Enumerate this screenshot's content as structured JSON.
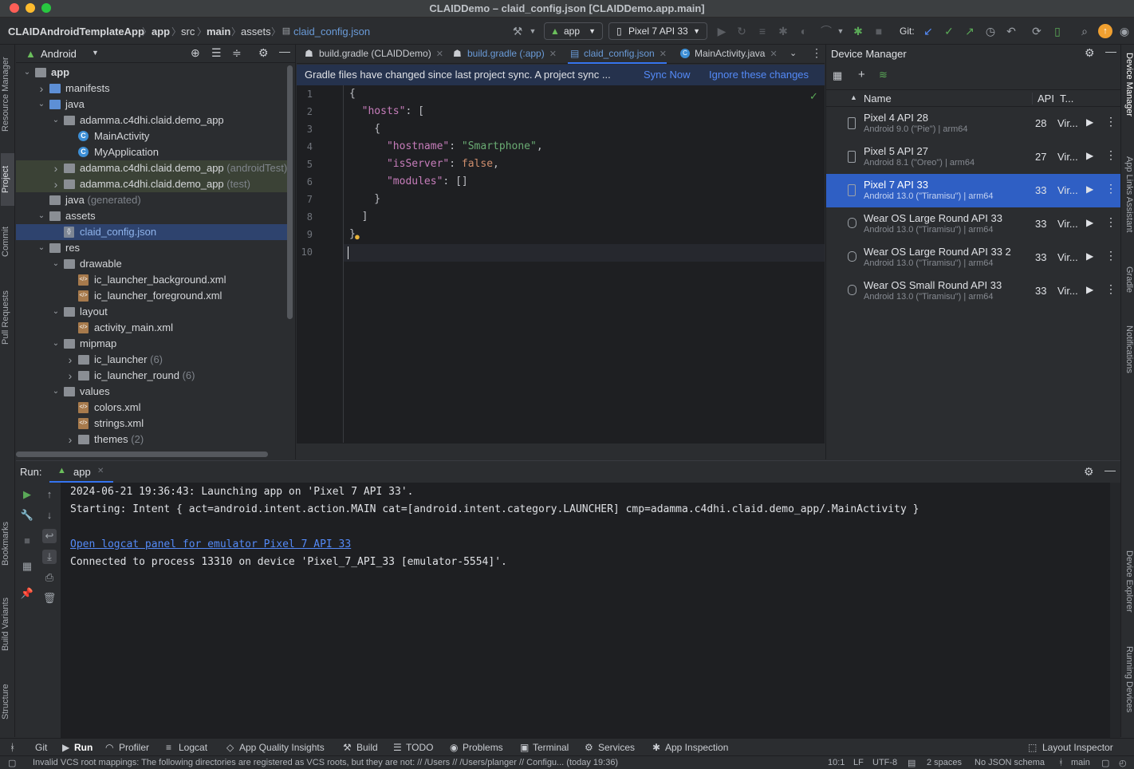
{
  "window": {
    "title": "CLAIDDemo – claid_config.json [CLAIDDemo.app.main]"
  },
  "breadcrumb": [
    "CLAIDAndroidTemplateApp",
    "app",
    "src",
    "main",
    "assets",
    "claid_config.json"
  ],
  "toolbar": {
    "run_config": "app",
    "device": "Pixel 7 API 33",
    "git_label": "Git:"
  },
  "left_tool_tabs": [
    "Resource Manager",
    "Project",
    "Commit",
    "Pull Requests",
    "Bookmarks",
    "Build Variants",
    "Structure"
  ],
  "right_tool_tabs": [
    "Device Manager",
    "App Links Assistant",
    "Gradle",
    "Notifications",
    "Device Explorer",
    "Running Devices"
  ],
  "project": {
    "view_label": "Android",
    "tree": [
      {
        "label": "app",
        "depth": 0,
        "chevron": "v",
        "icon": "folder",
        "bold": true
      },
      {
        "label": "manifests",
        "depth": 1,
        "chevron": ">",
        "icon": "folder-blue"
      },
      {
        "label": "java",
        "depth": 1,
        "chevron": "v",
        "icon": "folder-blue"
      },
      {
        "label": "adamma.c4dhi.claid.demo_app",
        "depth": 2,
        "chevron": "v",
        "icon": "folder"
      },
      {
        "label": "MainActivity",
        "depth": 3,
        "chevron": "",
        "icon": "class"
      },
      {
        "label": "MyApplication",
        "depth": 3,
        "chevron": "",
        "icon": "class"
      },
      {
        "label": "adamma.c4dhi.claid.demo_app",
        "suffix": "(androidTest)",
        "depth": 2,
        "chevron": ">",
        "icon": "folder",
        "hl": true
      },
      {
        "label": "adamma.c4dhi.claid.demo_app",
        "suffix": "(test)",
        "depth": 2,
        "chevron": ">",
        "icon": "folder",
        "hl": true
      },
      {
        "label": "java",
        "suffix": "(generated)",
        "depth": 1,
        "chevron": "",
        "icon": "folder"
      },
      {
        "label": "assets",
        "depth": 1,
        "chevron": "v",
        "icon": "folder"
      },
      {
        "label": "claid_config.json",
        "depth": 2,
        "chevron": "",
        "icon": "json",
        "sel": true
      },
      {
        "label": "res",
        "depth": 1,
        "chevron": "v",
        "icon": "folder"
      },
      {
        "label": "drawable",
        "depth": 2,
        "chevron": "v",
        "icon": "folder"
      },
      {
        "label": "ic_launcher_background.xml",
        "depth": 3,
        "chevron": "",
        "icon": "xml"
      },
      {
        "label": "ic_launcher_foreground.xml",
        "depth": 3,
        "chevron": "",
        "icon": "xml"
      },
      {
        "label": "layout",
        "depth": 2,
        "chevron": "v",
        "icon": "folder"
      },
      {
        "label": "activity_main.xml",
        "depth": 3,
        "chevron": "",
        "icon": "xml"
      },
      {
        "label": "mipmap",
        "depth": 2,
        "chevron": "v",
        "icon": "folder"
      },
      {
        "label": "ic_launcher",
        "suffix": "(6)",
        "depth": 3,
        "chevron": ">",
        "icon": "folder"
      },
      {
        "label": "ic_launcher_round",
        "suffix": "(6)",
        "depth": 3,
        "chevron": ">",
        "icon": "folder"
      },
      {
        "label": "values",
        "depth": 2,
        "chevron": "v",
        "icon": "folder"
      },
      {
        "label": "colors.xml",
        "depth": 3,
        "chevron": "",
        "icon": "xml"
      },
      {
        "label": "strings.xml",
        "depth": 3,
        "chevron": "",
        "icon": "xml"
      },
      {
        "label": "themes",
        "suffix": "(2)",
        "depth": 3,
        "chevron": ">",
        "icon": "folder"
      }
    ]
  },
  "editor": {
    "tabs": [
      {
        "label": "build.gradle (CLAIDDemo)",
        "active": false
      },
      {
        "label": "build.gradle (:app)",
        "active": false
      },
      {
        "label": "claid_config.json",
        "active": true
      },
      {
        "label": "MainActivity.java",
        "active": false
      }
    ],
    "sync_message": "Gradle files have changed since last project sync. A project sync ...",
    "sync_now": "Sync Now",
    "ignore": "Ignore these changes",
    "lines": [
      [
        "1",
        "{"
      ],
      [
        "2",
        "  \"hosts\": ["
      ],
      [
        "3",
        "    {"
      ],
      [
        "4",
        "      \"hostname\": \"Smartphone\","
      ],
      [
        "5",
        "      \"isServer\": false,"
      ],
      [
        "6",
        "      \"modules\": []"
      ],
      [
        "7",
        "    }"
      ],
      [
        "8",
        "  ]"
      ],
      [
        "9",
        "}"
      ],
      [
        "10",
        ""
      ]
    ]
  },
  "device_manager": {
    "title": "Device Manager",
    "columns": {
      "name": "Name",
      "api": "API",
      "type": "T..."
    },
    "devices": [
      {
        "name": "Pixel 4 API 28",
        "detail": "Android 9.0 (\"Pie\") | arm64",
        "api": "28",
        "type": "Vir...",
        "kind": "phone",
        "selected": false
      },
      {
        "name": "Pixel 5 API 27",
        "detail": "Android 8.1 (\"Oreo\") | arm64",
        "api": "27",
        "type": "Vir...",
        "kind": "phone",
        "selected": false
      },
      {
        "name": "Pixel 7 API 33",
        "detail": "Android 13.0 (\"Tiramisu\") | arm64",
        "api": "33",
        "type": "Vir...",
        "kind": "phone",
        "selected": true
      },
      {
        "name": "Wear OS Large Round API 33",
        "detail": "Android 13.0 (\"Tiramisu\") | arm64",
        "api": "33",
        "type": "Vir...",
        "kind": "watch",
        "selected": false
      },
      {
        "name": "Wear OS Large Round API 33 2",
        "detail": "Android 13.0 (\"Tiramisu\") | arm64",
        "api": "33",
        "type": "Vir...",
        "kind": "watch",
        "selected": false
      },
      {
        "name": "Wear OS Small Round API 33",
        "detail": "Android 13.0 (\"Tiramisu\") | arm64",
        "api": "33",
        "type": "Vir...",
        "kind": "watch",
        "selected": false
      }
    ]
  },
  "run": {
    "label": "Run:",
    "tab": "app",
    "lines": [
      {
        "text": "2024-06-21 19:36:43: Launching app on 'Pixel 7 API 33'.",
        "link": false
      },
      {
        "text": "Starting: Intent { act=android.intent.action.MAIN cat=[android.intent.category.LAUNCHER] cmp=adamma.c4dhi.claid.demo_app/.MainActivity }",
        "link": false
      },
      {
        "text": "",
        "link": false
      },
      {
        "text": "Open logcat panel for emulator Pixel 7 API 33",
        "link": true
      },
      {
        "text": "Connected to process 13310 on device 'Pixel_7_API_33 [emulator-5554]'.",
        "link": false
      }
    ]
  },
  "bottom_tabs": [
    "Git",
    "Run",
    "Profiler",
    "Logcat",
    "App Quality Insights",
    "Build",
    "TODO",
    "Problems",
    "Terminal",
    "Services",
    "App Inspection"
  ],
  "layout_inspector": "Layout Inspector",
  "status": {
    "message": "Invalid VCS root mappings: The following directories are registered as VCS roots, but they are not: // /Users // /Users/planger // Configu... (today 19:36)",
    "position": "10:1",
    "line_sep": "LF",
    "encoding": "UTF-8",
    "indent": "2 spaces",
    "schema": "No JSON schema",
    "branch": "main"
  }
}
